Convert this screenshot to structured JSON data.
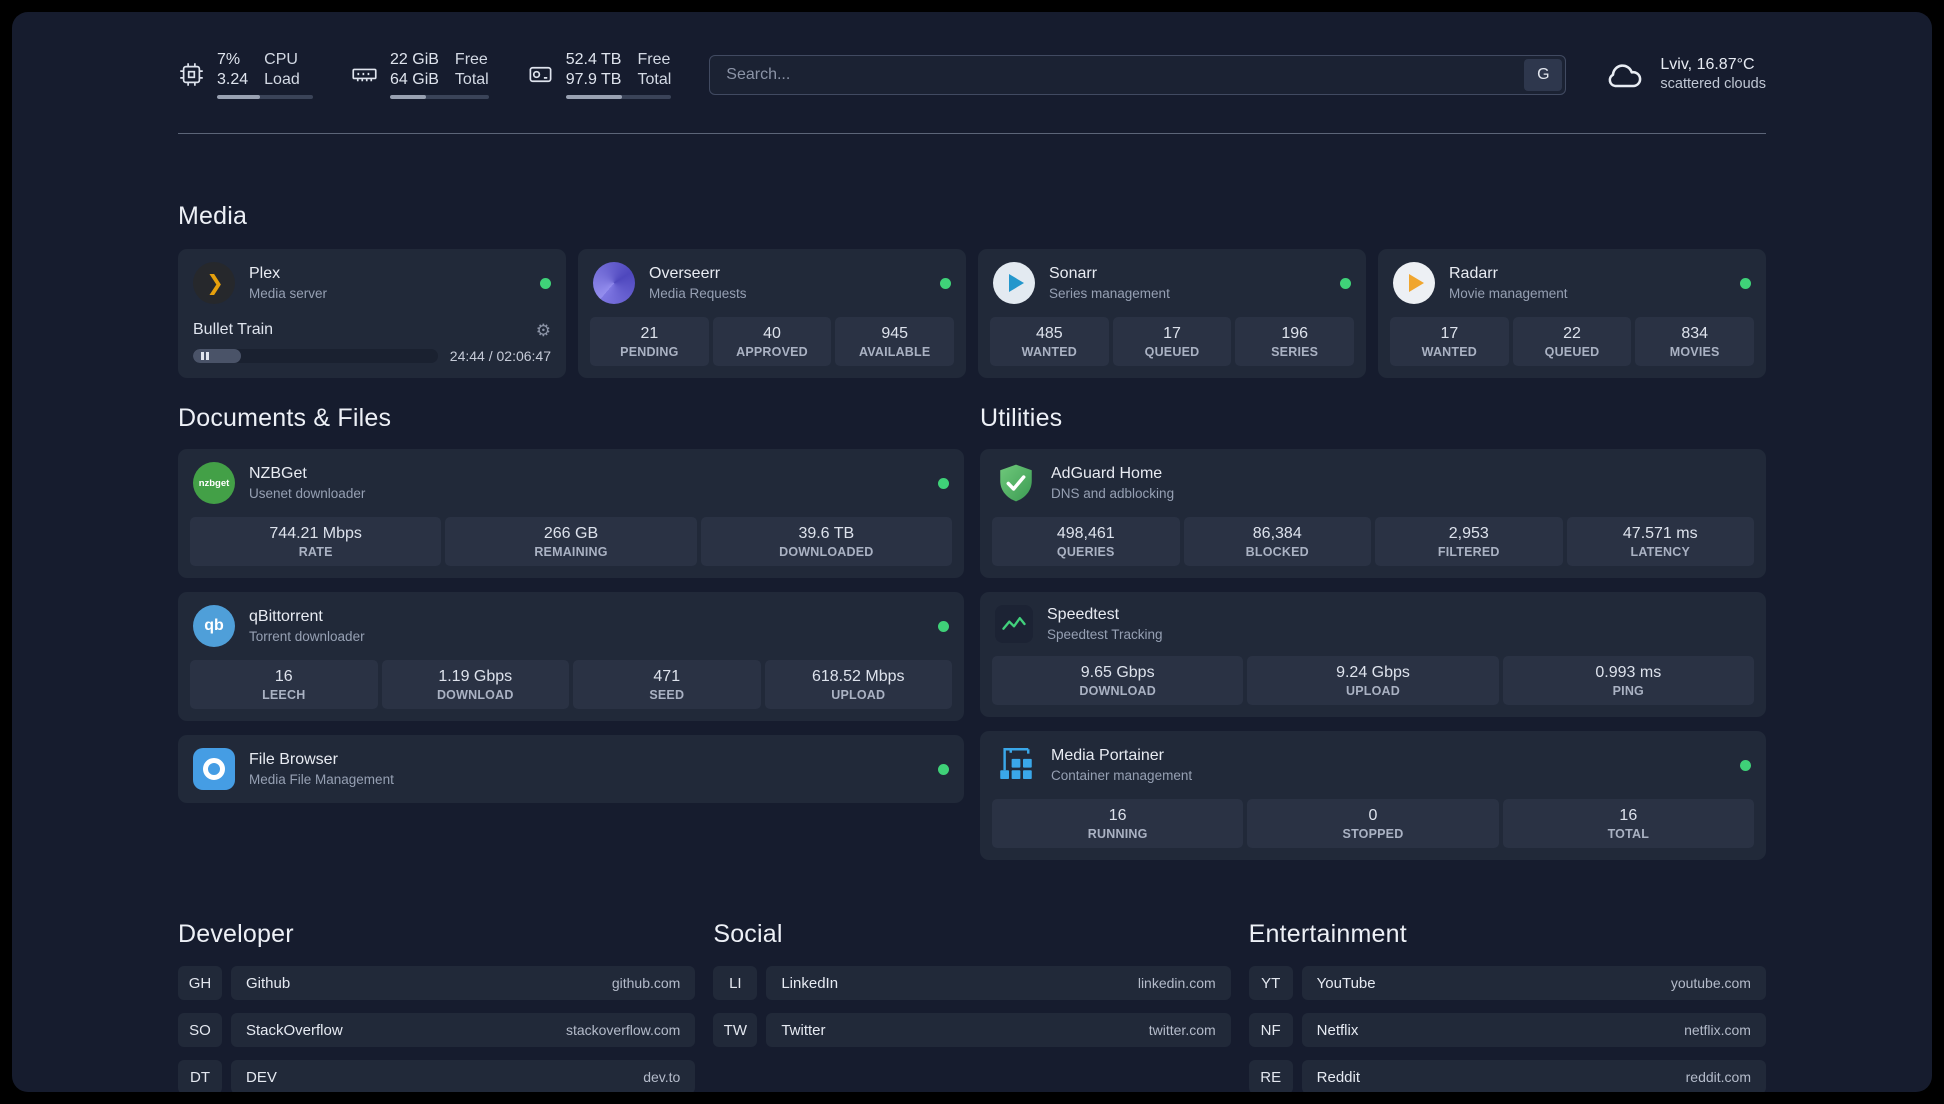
{
  "topbar": {
    "cpu": {
      "value_primary": "7%",
      "value_secondary": "3.24",
      "label_primary": "CPU",
      "label_secondary": "Load",
      "progress": 45
    },
    "memory": {
      "value_primary": "22 GiB",
      "value_secondary": "64 GiB",
      "label_primary": "Free",
      "label_secondary": "Total",
      "progress": 36
    },
    "disk": {
      "value_primary": "52.4 TB",
      "value_secondary": "97.9 TB",
      "label_primary": "Free",
      "label_secondary": "Total",
      "progress": 53
    },
    "search": {
      "placeholder": "Search...",
      "provider": "G"
    },
    "weather": {
      "location": "Lviv, 16.87°C",
      "condition": "scattered clouds"
    }
  },
  "media": {
    "title": "Media",
    "plex": {
      "name": "Plex",
      "desc": "Media server",
      "now_playing": "Bullet Train",
      "elapsed": "24:44 / 02:06:47",
      "progress": 19.5
    },
    "overseerr": {
      "name": "Overseerr",
      "desc": "Media Requests",
      "stats": [
        {
          "value": "21",
          "label": "PENDING"
        },
        {
          "value": "40",
          "label": "APPROVED"
        },
        {
          "value": "945",
          "label": "AVAILABLE"
        }
      ]
    },
    "sonarr": {
      "name": "Sonarr",
      "desc": "Series management",
      "stats": [
        {
          "value": "485",
          "label": "WANTED"
        },
        {
          "value": "17",
          "label": "QUEUED"
        },
        {
          "value": "196",
          "label": "SERIES"
        }
      ]
    },
    "radarr": {
      "name": "Radarr",
      "desc": "Movie management",
      "stats": [
        {
          "value": "17",
          "label": "WANTED"
        },
        {
          "value": "22",
          "label": "QUEUED"
        },
        {
          "value": "834",
          "label": "MOVIES"
        }
      ]
    }
  },
  "documents": {
    "title": "Documents & Files",
    "nzbget": {
      "name": "NZBGet",
      "desc": "Usenet downloader",
      "icon_text": "nzbget",
      "stats": [
        {
          "value": "744.21 Mbps",
          "label": "RATE"
        },
        {
          "value": "266 GB",
          "label": "REMAINING"
        },
        {
          "value": "39.6 TB",
          "label": "DOWNLOADED"
        }
      ]
    },
    "qbittorrent": {
      "name": "qBittorrent",
      "desc": "Torrent downloader",
      "icon_text": "qb",
      "stats": [
        {
          "value": "16",
          "label": "LEECH"
        },
        {
          "value": "1.19 Gbps",
          "label": "DOWNLOAD"
        },
        {
          "value": "471",
          "label": "SEED"
        },
        {
          "value": "618.52 Mbps",
          "label": "UPLOAD"
        }
      ]
    },
    "filebrowser": {
      "name": "File Browser",
      "desc": "Media File Management"
    }
  },
  "utilities": {
    "title": "Utilities",
    "adguard": {
      "name": "AdGuard Home",
      "desc": "DNS and adblocking",
      "stats": [
        {
          "value": "498,461",
          "label": "QUERIES"
        },
        {
          "value": "86,384",
          "label": "BLOCKED"
        },
        {
          "value": "2,953",
          "label": "FILTERED"
        },
        {
          "value": "47.571 ms",
          "label": "LATENCY"
        }
      ]
    },
    "speedtest": {
      "name": "Speedtest",
      "desc": "Speedtest Tracking",
      "stats": [
        {
          "value": "9.65 Gbps",
          "label": "DOWNLOAD"
        },
        {
          "value": "9.24 Gbps",
          "label": "UPLOAD"
        },
        {
          "value": "0.993 ms",
          "label": "PING"
        }
      ]
    },
    "portainer": {
      "name": "Media Portainer",
      "desc": "Container management",
      "stats": [
        {
          "value": "16",
          "label": "RUNNING"
        },
        {
          "value": "0",
          "label": "STOPPED"
        },
        {
          "value": "16",
          "label": "TOTAL"
        }
      ]
    }
  },
  "bookmarks": {
    "developer": {
      "title": "Developer",
      "items": [
        {
          "abbr": "GH",
          "name": "Github",
          "url": "github.com"
        },
        {
          "abbr": "SO",
          "name": "StackOverflow",
          "url": "stackoverflow.com"
        },
        {
          "abbr": "DT",
          "name": "DEV",
          "url": "dev.to"
        }
      ]
    },
    "social": {
      "title": "Social",
      "items": [
        {
          "abbr": "LI",
          "name": "LinkedIn",
          "url": "linkedin.com"
        },
        {
          "abbr": "TW",
          "name": "Twitter",
          "url": "twitter.com"
        }
      ]
    },
    "entertainment": {
      "title": "Entertainment",
      "items": [
        {
          "abbr": "YT",
          "name": "YouTube",
          "url": "youtube.com"
        },
        {
          "abbr": "NF",
          "name": "Netflix",
          "url": "netflix.com"
        },
        {
          "abbr": "RE",
          "name": "Reddit",
          "url": "reddit.com"
        }
      ]
    }
  },
  "colors": {
    "accent_green": "#3fd178",
    "plex_amber": "#e5a00d",
    "background": "#161c2e"
  }
}
